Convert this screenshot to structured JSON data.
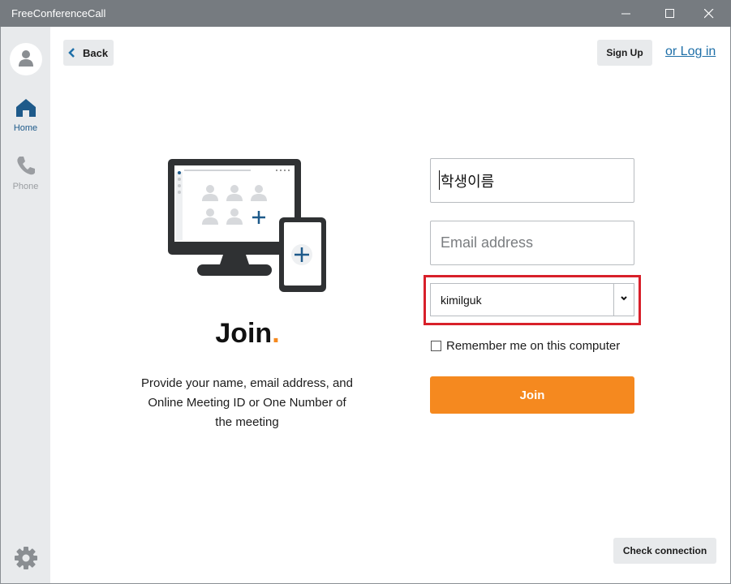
{
  "window": {
    "title": "FreeConferenceCall",
    "controls": [
      "minimize-icon",
      "maximize-icon",
      "close-icon"
    ]
  },
  "sidebar": {
    "avatar_icon": "user-icon",
    "items": [
      {
        "label": "Home",
        "icon": "home-icon",
        "active": true
      },
      {
        "label": "Phone",
        "icon": "phone-icon",
        "active": false
      }
    ],
    "settings_icon": "gear-icon"
  },
  "header": {
    "back_label": "Back",
    "signup_label": "Sign Up",
    "login_label": "or Log in"
  },
  "main": {
    "title": "Join",
    "title_dot": ".",
    "description": "Provide your name, email address, and Online Meeting ID or One Number of the meeting"
  },
  "form": {
    "name_value": "학생이름",
    "email_placeholder": "Email address",
    "meeting_selected": "kimilguk",
    "remember_label": "Remember me on this computer",
    "remember_checked": false,
    "join_label": "Join"
  },
  "footer": {
    "check_connection_label": "Check connection"
  },
  "colors": {
    "accent": "#f5891f",
    "link": "#1e6fa8",
    "active_nav": "#1e5a8a",
    "highlight": "#d8202a",
    "titlebar": "#767b80"
  }
}
